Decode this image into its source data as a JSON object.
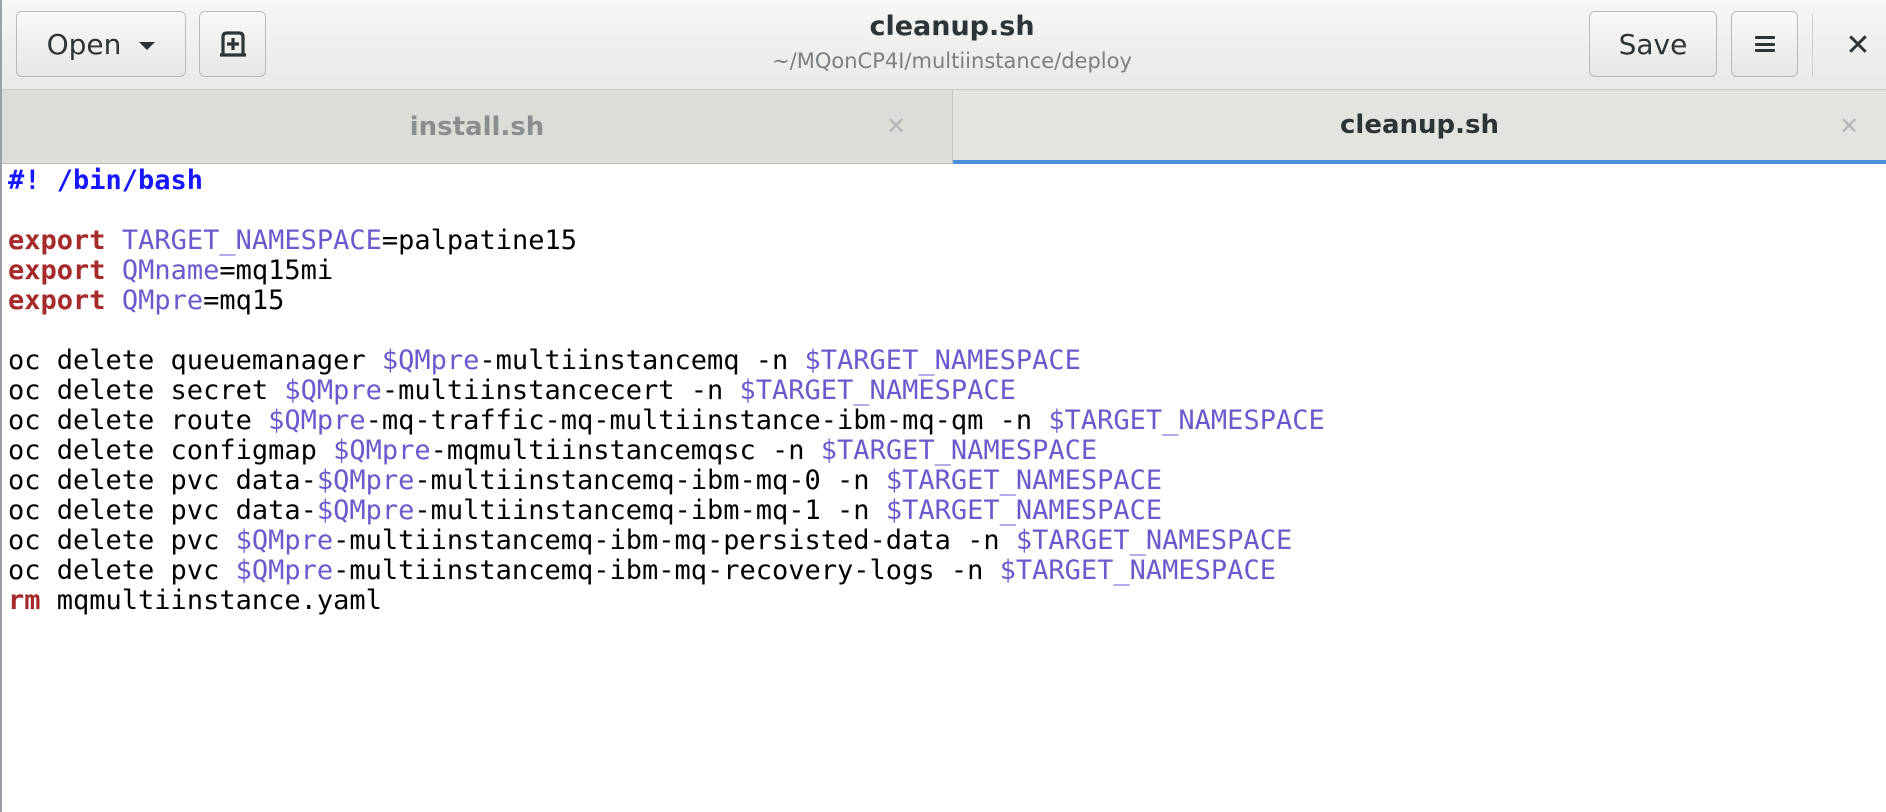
{
  "headerbar": {
    "open_label": "Open",
    "title": "cleanup.sh",
    "subtitle": "~/MQonCP4I/multiinstance/deploy",
    "save_label": "Save"
  },
  "tabs": [
    {
      "label": "install.sh",
      "active": false
    },
    {
      "label": "cleanup.sh",
      "active": true
    }
  ],
  "editor": {
    "lines": [
      [
        {
          "t": "#! /bin/bash",
          "c": "shebang"
        }
      ],
      [],
      [
        {
          "t": "export",
          "c": "kw"
        },
        {
          "t": " ",
          "c": "plain"
        },
        {
          "t": "TARGET_NAMESPACE",
          "c": "var"
        },
        {
          "t": "=palpatine15",
          "c": "plain"
        }
      ],
      [
        {
          "t": "export",
          "c": "kw"
        },
        {
          "t": " ",
          "c": "plain"
        },
        {
          "t": "QMname",
          "c": "var"
        },
        {
          "t": "=mq15mi",
          "c": "plain"
        }
      ],
      [
        {
          "t": "export",
          "c": "kw"
        },
        {
          "t": " ",
          "c": "plain"
        },
        {
          "t": "QMpre",
          "c": "var"
        },
        {
          "t": "=mq15",
          "c": "plain"
        }
      ],
      [],
      [
        {
          "t": "oc delete queuemanager ",
          "c": "plain"
        },
        {
          "t": "$QMpre",
          "c": "var"
        },
        {
          "t": "-multiinstancemq -n ",
          "c": "plain"
        },
        {
          "t": "$TARGET_NAMESPACE",
          "c": "var"
        }
      ],
      [
        {
          "t": "oc delete secret ",
          "c": "plain"
        },
        {
          "t": "$QMpre",
          "c": "var"
        },
        {
          "t": "-multiinstancecert -n ",
          "c": "plain"
        },
        {
          "t": "$TARGET_NAMESPACE",
          "c": "var"
        }
      ],
      [
        {
          "t": "oc delete route ",
          "c": "plain"
        },
        {
          "t": "$QMpre",
          "c": "var"
        },
        {
          "t": "-mq-traffic-mq-multiinstance-ibm-mq-qm -n ",
          "c": "plain"
        },
        {
          "t": "$TARGET_NAMESPACE",
          "c": "var"
        }
      ],
      [
        {
          "t": "oc delete configmap ",
          "c": "plain"
        },
        {
          "t": "$QMpre",
          "c": "var"
        },
        {
          "t": "-mqmultiinstancemqsc -n ",
          "c": "plain"
        },
        {
          "t": "$TARGET_NAMESPACE",
          "c": "var"
        }
      ],
      [
        {
          "t": "oc delete pvc data-",
          "c": "plain"
        },
        {
          "t": "$QMpre",
          "c": "var"
        },
        {
          "t": "-multiinstancemq-ibm-mq-0 -n ",
          "c": "plain"
        },
        {
          "t": "$TARGET_NAMESPACE",
          "c": "var"
        }
      ],
      [
        {
          "t": "oc delete pvc data-",
          "c": "plain"
        },
        {
          "t": "$QMpre",
          "c": "var"
        },
        {
          "t": "-multiinstancemq-ibm-mq-1 -n ",
          "c": "plain"
        },
        {
          "t": "$TARGET_NAMESPACE",
          "c": "var"
        }
      ],
      [
        {
          "t": "oc delete pvc ",
          "c": "plain"
        },
        {
          "t": "$QMpre",
          "c": "var"
        },
        {
          "t": "-multiinstancemq-ibm-mq-persisted-data -n ",
          "c": "plain"
        },
        {
          "t": "$TARGET_NAMESPACE",
          "c": "var"
        }
      ],
      [
        {
          "t": "oc delete pvc ",
          "c": "plain"
        },
        {
          "t": "$QMpre",
          "c": "var"
        },
        {
          "t": "-multiinstancemq-ibm-mq-recovery-logs -n ",
          "c": "plain"
        },
        {
          "t": "$TARGET_NAMESPACE",
          "c": "var"
        }
      ],
      [
        {
          "t": "rm",
          "c": "kw"
        },
        {
          "t": " mqmultiinstance.yaml",
          "c": "plain"
        }
      ]
    ]
  },
  "icons": {
    "open_menu": "chevron-down-icon",
    "new_document": "new-document-icon",
    "hamburger": "hamburger-menu-icon",
    "close_window": "close-icon",
    "tab_close": "close-icon"
  },
  "colors": {
    "shebang": "#1616ff",
    "keyword": "#a52a2a",
    "variable": "#6a5acd",
    "active_tab_underline": "#4a90d9"
  }
}
